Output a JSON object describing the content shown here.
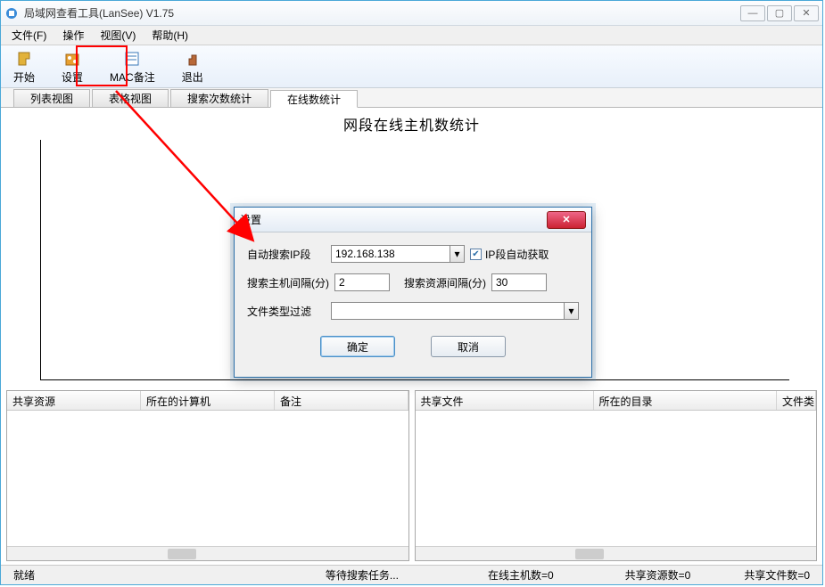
{
  "window": {
    "title": "局域网查看工具(LanSee) V1.75"
  },
  "menubar": {
    "file": "文件(F)",
    "operation": "操作",
    "view": "视图(V)",
    "help": "帮助(H)"
  },
  "toolbar": {
    "start": "开始",
    "settings": "设置",
    "mac_note": "MAC备注",
    "exit": "退出"
  },
  "tabs": {
    "list_view": "列表视图",
    "table_view": "表格视图",
    "search_stats": "搜索次数统计",
    "online_stats": "在线数统计"
  },
  "chart": {
    "title": "网段在线主机数统计"
  },
  "pane_left": {
    "col1": "共享资源",
    "col2": "所在的计算机",
    "col3": "备注"
  },
  "pane_right": {
    "col1": "共享文件",
    "col2": "所在的目录",
    "col3": "文件类"
  },
  "status": {
    "ready": "就绪",
    "waiting": "等待搜索任务...",
    "online": "在线主机数=0",
    "shares": "共享资源数=0",
    "files": "共享文件数=0"
  },
  "dialog": {
    "title_fragment": "设置",
    "row1_label": "自动搜索IP段",
    "ip_value": "192.168.138",
    "auto_get_label": "IP段自动获取",
    "row2_label1": "搜索主机间隔(分)",
    "interval_host": "2",
    "row2_label2": "搜索资源间隔(分)",
    "interval_res": "30",
    "row3_label": "文件类型过滤",
    "filter_value": "",
    "ok": "确定",
    "cancel": "取消"
  },
  "chart_data": {
    "type": "bar",
    "title": "网段在线主机数统计",
    "categories": [],
    "values": [],
    "xlabel": "",
    "ylabel": "",
    "ylim": [
      0,
      0
    ]
  }
}
